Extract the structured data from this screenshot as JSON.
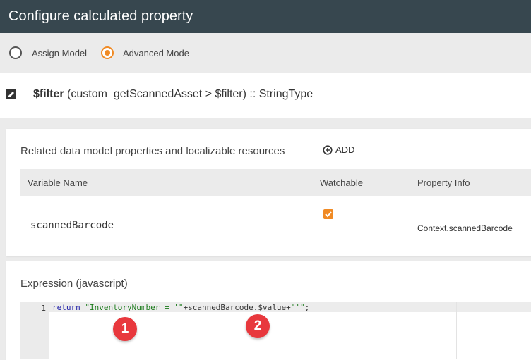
{
  "window": {
    "title": "Configure calculated property"
  },
  "modes": {
    "assign_label": "Assign Model",
    "advanced_label": "Advanced Mode",
    "selected": "Advanced Mode"
  },
  "filter": {
    "name": "$filter",
    "detail": "(custom_getScannedAsset > $filter) :: StringType"
  },
  "related": {
    "title": "Related data model properties and localizable resources",
    "add_label": "ADD",
    "columns": [
      "Variable Name",
      "Watchable",
      "Property Info"
    ],
    "rows": [
      {
        "variable": "scannedBarcode",
        "watchable": true,
        "property_info": "Context.scannedBarcode"
      }
    ]
  },
  "expression": {
    "title": "Expression (javascript)",
    "line_number": "1",
    "code": {
      "keyword": "return",
      "str1": "\"InventoryNumber = '\"",
      "mid": "+scannedBarcode.$value+",
      "str2": "\"'\"",
      "end": ";"
    }
  },
  "annotations": [
    "1",
    "2"
  ],
  "colors": {
    "titlebar": "#37474f",
    "accent": "#f08a24",
    "badge": "#e8383d"
  }
}
